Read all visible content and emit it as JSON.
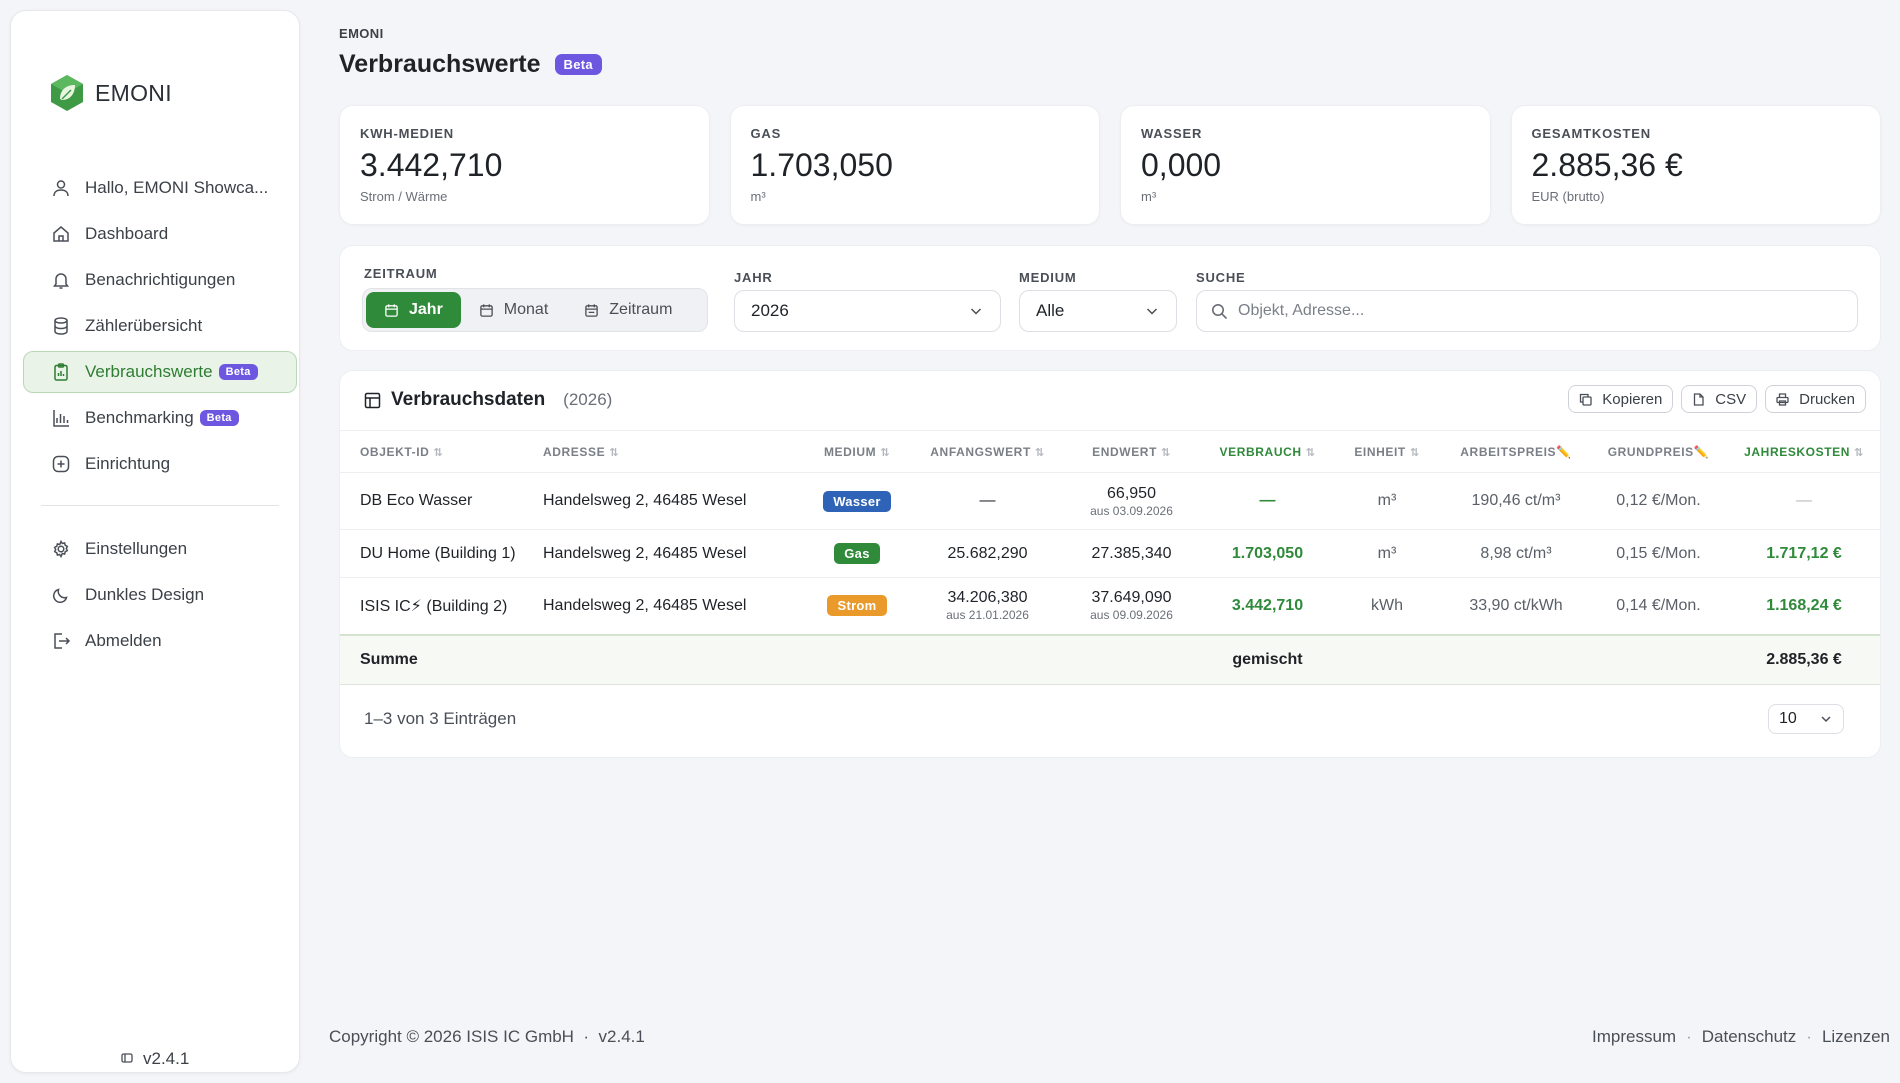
{
  "app": {
    "brand": "EMONI",
    "version": "v2.4.1"
  },
  "sidebar": {
    "items": [
      {
        "label": "Hallo, EMONI Showca...",
        "icon": "user-icon"
      },
      {
        "label": "Dashboard",
        "icon": "home-icon"
      },
      {
        "label": "Benachrichtigungen",
        "icon": "bell-icon"
      },
      {
        "label": "Zählerübersicht",
        "icon": "database-icon"
      },
      {
        "label": "Verbrauchswerte",
        "icon": "clipboard-icon",
        "badge": "Beta",
        "active": true
      },
      {
        "label": "Benchmarking",
        "icon": "bar-chart-icon",
        "badge": "Beta"
      },
      {
        "label": "Einrichtung",
        "icon": "plus-circle-icon"
      },
      {
        "label": "Einstellungen",
        "icon": "gear-icon"
      },
      {
        "label": "Dunkles Design",
        "icon": "moon-icon"
      },
      {
        "label": "Abmelden",
        "icon": "logout-icon"
      }
    ]
  },
  "header": {
    "breadcrumb": "EMONI",
    "title": "Verbrauchswerte",
    "badge": "Beta"
  },
  "cards": [
    {
      "label": "KWH-MEDIEN",
      "value": "3.442,710",
      "unit": "Strom / Wärme"
    },
    {
      "label": "GAS",
      "value": "1.703,050",
      "unit": "m³"
    },
    {
      "label": "WASSER",
      "value": "0,000",
      "unit": "m³"
    },
    {
      "label": "GESAMTKOSTEN",
      "value": "2.885,36 €",
      "unit": "EUR (brutto)"
    }
  ],
  "filters": {
    "zeitraum_label": "ZEITRAUM",
    "segments": [
      "Jahr",
      "Monat",
      "Zeitraum"
    ],
    "active_segment": "Jahr",
    "jahr_label": "JAHR",
    "jahr_value": "2026",
    "medium_label": "MEDIUM",
    "medium_value": "Alle",
    "suche_label": "SUCHE",
    "suche_placeholder": "Objekt, Adresse..."
  },
  "table": {
    "title": "Verbrauchsdaten",
    "subtitle": "(2026)",
    "actions": [
      "Kopieren",
      "CSV",
      "Drucken"
    ],
    "columns": [
      "OBJEKT-ID",
      "ADRESSE",
      "MEDIUM",
      "ANFANGSWERT",
      "ENDWERT",
      "VERBRAUCH",
      "EINHEIT",
      "ARBEITSPREIS",
      "GRUNDPREIS",
      "JAHRESKOSTEN"
    ],
    "rows": [
      {
        "objekt": "DB Eco Wasser",
        "adresse": "Handelsweg 2, 46485 Wesel",
        "medium": "Wasser",
        "anfang": "—",
        "anfang_sub": "",
        "end": "66,950",
        "end_sub": "aus 03.09.2026",
        "verbrauch": "—",
        "einheit": "m³",
        "arbeitspreis": "190,46 ct/m³",
        "grundpreis": "0,12 €/Mon.",
        "jahreskosten": "—"
      },
      {
        "objekt": "DU Home (Building 1)",
        "adresse": "Handelsweg 2, 46485 Wesel",
        "medium": "Gas",
        "anfang": "25.682,290",
        "anfang_sub": "",
        "end": "27.385,340",
        "end_sub": "",
        "verbrauch": "1.703,050",
        "einheit": "m³",
        "arbeitspreis": "8,98 ct/m³",
        "grundpreis": "0,15 €/Mon.",
        "jahreskosten": "1.717,12 €"
      },
      {
        "objekt": "ISIS IC⚡ (Building 2)",
        "adresse": "Handelsweg 2, 46485 Wesel",
        "medium": "Strom",
        "anfang": "34.206,380",
        "anfang_sub": "aus 21.01.2026",
        "end": "37.649,090",
        "end_sub": "aus 09.09.2026",
        "verbrauch": "3.442,710",
        "einheit": "kWh",
        "arbeitspreis": "33,90 ct/kWh",
        "grundpreis": "0,14 €/Mon.",
        "jahreskosten": "1.168,24 €"
      }
    ],
    "sum": {
      "label": "Summe",
      "verbrauch": "gemischt",
      "jahreskosten": "2.885,36 €"
    },
    "footer_text": "1–3 von 3 Einträgen",
    "page_size": "10"
  },
  "footer": {
    "copyright": "Copyright © 2026 ISIS IC GmbH  ·  v2.4.1",
    "links": [
      "Impressum",
      "Datenschutz",
      "Lizenzen"
    ]
  },
  "colors": {
    "accent": "#2f8a3a",
    "beta": "#6d57e0",
    "wasser": "#2f63b8",
    "gas": "#2f8a3a",
    "strom": "#e99a2a"
  }
}
